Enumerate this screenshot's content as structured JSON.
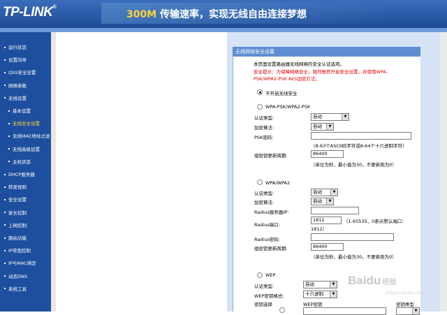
{
  "header": {
    "logo": "TP-LINK",
    "logo_mark": "®",
    "slogan_highlight": "300M",
    "slogan_rest": " 传输速率，实现无线自由连接梦想"
  },
  "sidebar": {
    "items": [
      {
        "label": "运行状态",
        "sub": false,
        "active": false
      },
      {
        "label": "设置向导",
        "sub": false,
        "active": false
      },
      {
        "label": "QSS安全设置",
        "sub": false,
        "active": false
      },
      {
        "label": "网络参数",
        "sub": false,
        "active": false
      },
      {
        "label": "无线设置",
        "sub": false,
        "active": false
      },
      {
        "label": "基本设置",
        "sub": true,
        "active": false
      },
      {
        "label": "无线安全设置",
        "sub": true,
        "active": true
      },
      {
        "label": "无线MAC地址过滤",
        "sub": true,
        "active": false
      },
      {
        "label": "无线高级设置",
        "sub": true,
        "active": false
      },
      {
        "label": "主机状态",
        "sub": true,
        "active": false
      },
      {
        "label": "DHCP服务器",
        "sub": false,
        "active": false
      },
      {
        "label": "转发规则",
        "sub": false,
        "active": false
      },
      {
        "label": "安全设置",
        "sub": false,
        "active": false
      },
      {
        "label": "家长控制",
        "sub": false,
        "active": false
      },
      {
        "label": "上网控制",
        "sub": false,
        "active": false
      },
      {
        "label": "路由功能",
        "sub": false,
        "active": false
      },
      {
        "label": "IP带宽控制",
        "sub": false,
        "active": false
      },
      {
        "label": "IP与MAC绑定",
        "sub": false,
        "active": false
      },
      {
        "label": "动态DNS",
        "sub": false,
        "active": false
      },
      {
        "label": "系统工具",
        "sub": false,
        "active": false
      }
    ]
  },
  "panel": {
    "title": "无线网络安全设置",
    "intro": "本页面设置路由器无线网络的安全认证选项。",
    "tip_line1": "安全提示：为保障网络安全，强烈推荐开启安全设置，并使用WPA-",
    "tip_line2": "PSK/WPA2-PSK AES加密方法。",
    "no_security": "不开启无线安全",
    "wpa_psk": {
      "heading": "WPA-PSK/WPA2-PSK",
      "auth_label": "认证类型:",
      "auth_value": "自动",
      "enc_label": "加密算法:",
      "enc_value": "自动",
      "psk_label": "PSK密码:",
      "psk_value": "",
      "psk_hint": "（8-63个ASCII码字符或8-64个十六进制字符）",
      "renew_label": "组密钥更新周期:",
      "renew_value": "86400",
      "renew_hint": "（单位为秒，最小值为30，不更新则为0）"
    },
    "wpa": {
      "heading": "WPA/WPA2",
      "auth_label": "认证类型:",
      "auth_value": "自动",
      "enc_label": "加密算法:",
      "enc_value": "自动",
      "radius_ip_label": "Radius服务器IP:",
      "radius_ip_value": "",
      "radius_port_label": "Radius端口:",
      "radius_port_value": "1812",
      "radius_port_hint1": "（1-65535，0表示默认端口：",
      "radius_port_hint2": "1812）",
      "radius_pwd_label": "Radius密码:",
      "radius_pwd_value": "",
      "renew_label": "组密钥更新周期:",
      "renew_value": "86400",
      "renew_hint": "（单位为秒，最小值为30，不更新则为0）"
    },
    "wep": {
      "heading": "WEP",
      "auth_label": "认证类型:",
      "auth_value": "自动",
      "format_label": "WEP密钥格式:",
      "format_value": "十六进制",
      "col_key_select": "密钥选择",
      "col_key": "WEP密钥",
      "col_type": "密钥类型"
    }
  },
  "watermark": {
    "brand": "Baidu",
    "cn": "经验",
    "url": "jingyan.baidu.com"
  }
}
